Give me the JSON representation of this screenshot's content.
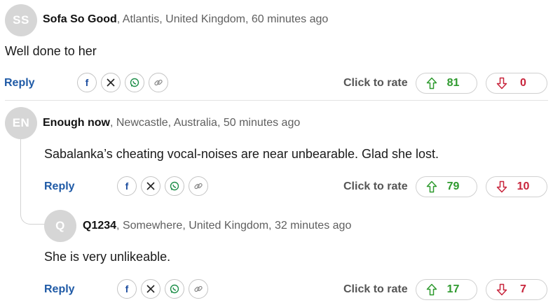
{
  "comments": [
    {
      "initials": "SS",
      "author": "Sofa So Good",
      "meta": ", Atlantis, United Kingdom, 60 minutes ago",
      "text": "Well done to her",
      "reply_label": "Reply",
      "rate_label": "Click to rate",
      "upvotes": "81",
      "downvotes": "0"
    },
    {
      "initials": "EN",
      "author": "Enough now",
      "meta": ", Newcastle, Australia, 50 minutes ago",
      "text": "Sabalanka’s cheating vocal-noises are near unbearable. Glad she lost.",
      "reply_label": "Reply",
      "rate_label": "Click to rate",
      "upvotes": "79",
      "downvotes": "10"
    },
    {
      "initials": "Q",
      "author": "Q1234",
      "meta": ", Somewhere, United Kingdom, 32 minutes ago",
      "text": "She is very unlikeable.",
      "reply_label": "Reply",
      "rate_label": "Click to rate",
      "upvotes": "17",
      "downvotes": "7"
    }
  ],
  "share_icons": [
    "facebook-icon",
    "x-icon",
    "whatsapp-icon",
    "link-icon"
  ],
  "colors": {
    "reply": "#1f5aa6",
    "upvote": "#2e9a2e",
    "downvote": "#c8243b",
    "avatar": "#d6d6d6"
  }
}
